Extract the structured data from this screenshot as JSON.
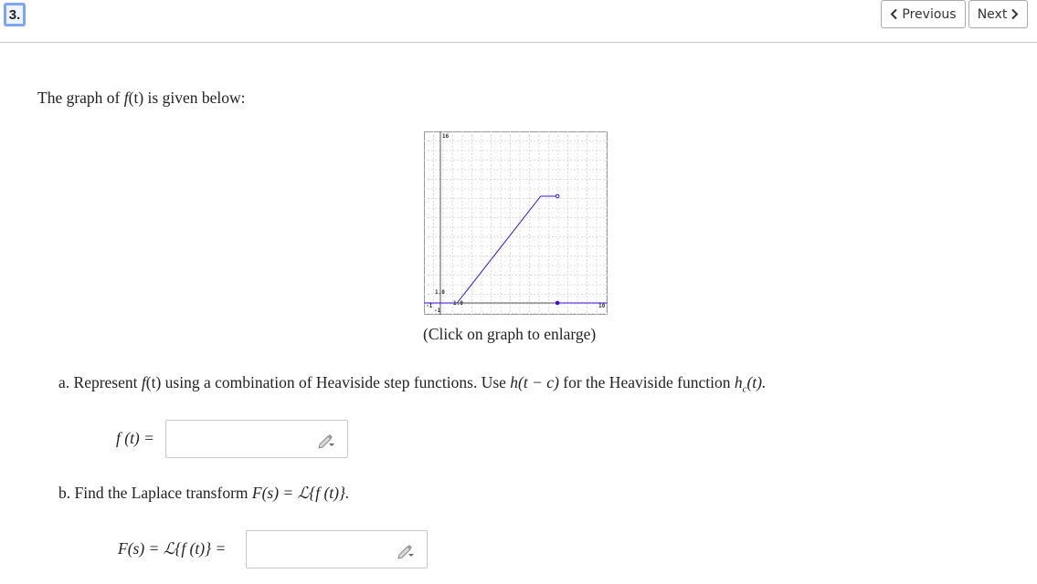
{
  "question": {
    "number": "3."
  },
  "nav": {
    "previous_label": "Previous",
    "next_label": "Next"
  },
  "prompt": {
    "prefix": "The graph of ",
    "func": "f",
    "arg": "(t)",
    "suffix": " is given below:"
  },
  "graph": {
    "caption": "(Click on graph to enlarge)",
    "line_color": "#3a10d8",
    "tick_labels": {
      "x_min": "-1",
      "x_max": "10",
      "x_mark": "1.0",
      "y_max": "16",
      "y_mark": "1.0",
      "y_min": "-1"
    },
    "chart_data": {
      "type": "line",
      "xlim": [
        -1,
        10
      ],
      "ylim": [
        -1,
        10
      ],
      "grid": true,
      "series": [
        {
          "x": [
            -1,
            1
          ],
          "y": [
            0,
            0
          ]
        },
        {
          "x": [
            1,
            6,
            7
          ],
          "y": [
            0,
            6.5,
            6.5
          ],
          "end_marker": "open"
        },
        {
          "x": [
            7,
            10
          ],
          "y": [
            0,
            0
          ],
          "start_marker": "filled"
        }
      ]
    }
  },
  "part_a": {
    "text1": "a. Represent ",
    "func": "f",
    "arg": "(t)",
    "text2": " using a combination of Heaviside step functions. Use ",
    "h": "h",
    "harg": "(t − c)",
    "text3": " for the Heaviside function ",
    "hc": "h",
    "hc_sub": "c",
    "hc_arg": "(t).",
    "answer_label": "f (t) =",
    "answer_value": ""
  },
  "part_b": {
    "text1": "b. Find the Laplace transform ",
    "expr": "F(s) = ℒ{f (t)}.",
    "answer_label": "F(s) = ℒ{f (t)} =",
    "answer_value": ""
  }
}
